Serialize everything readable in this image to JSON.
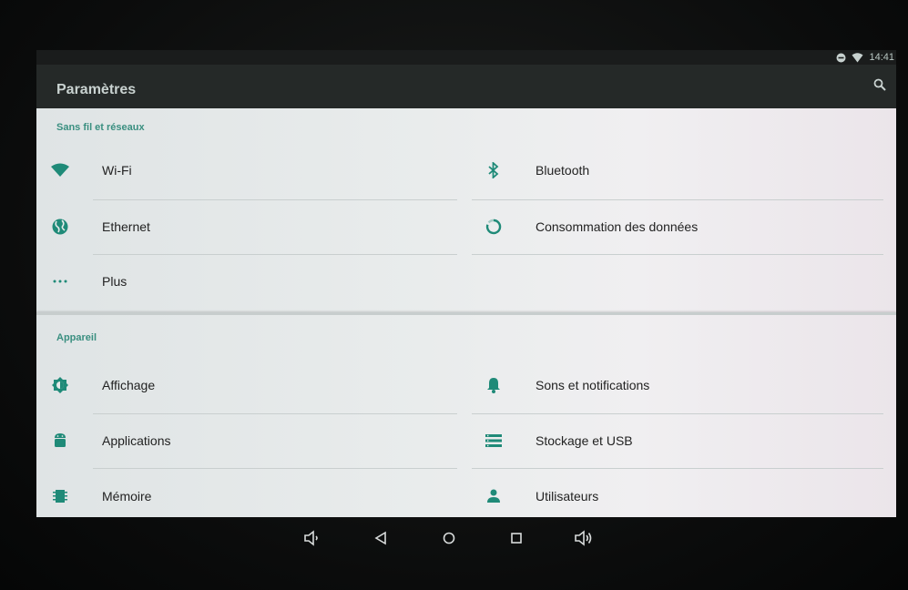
{
  "status": {
    "time": "14:41",
    "icons": [
      "dnd-icon",
      "wifi-icon"
    ]
  },
  "app": {
    "title": "Paramètres",
    "search_icon": "search-icon"
  },
  "sections": [
    {
      "header": "Sans fil et réseaux",
      "items": [
        {
          "label": "Wi-Fi",
          "icon": "wifi-icon"
        },
        {
          "label": "Bluetooth",
          "icon": "bluetooth-icon"
        },
        {
          "label": "Ethernet",
          "icon": "ethernet-icon"
        },
        {
          "label": "Consommation des données",
          "icon": "data-usage-icon"
        },
        {
          "label": "Plus",
          "icon": "more-icon"
        }
      ]
    },
    {
      "header": "Appareil",
      "items": [
        {
          "label": "Affichage",
          "icon": "display-icon"
        },
        {
          "label": "Sons et notifications",
          "icon": "bell-icon"
        },
        {
          "label": "Applications",
          "icon": "android-icon"
        },
        {
          "label": "Stockage et USB",
          "icon": "storage-icon"
        },
        {
          "label": "Mémoire",
          "icon": "memory-icon"
        },
        {
          "label": "Utilisateurs",
          "icon": "user-icon"
        }
      ]
    }
  ],
  "navbar": [
    "volume-down-icon",
    "back-icon",
    "home-icon",
    "recents-icon",
    "volume-up-icon"
  ],
  "colors": {
    "accent": "#1f8a78",
    "appbar": "#252928",
    "text": "#222222"
  }
}
